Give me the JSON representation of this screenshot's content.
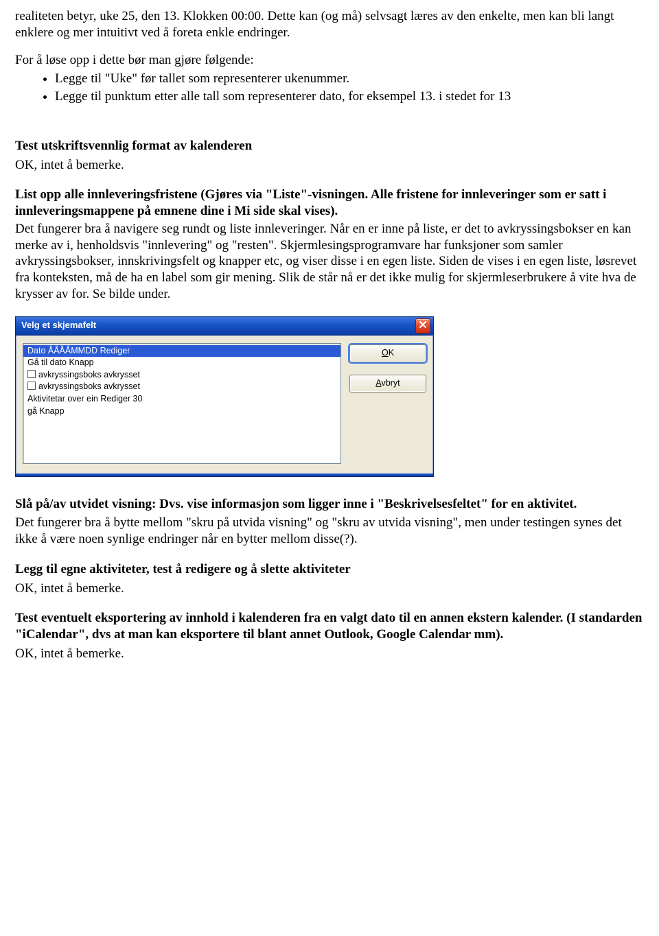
{
  "intro": {
    "p1": "realiteten betyr, uke 25, den 13. Klokken 00:00. Dette kan (og må) selvsagt læres av den enkelte, men kan bli langt enklere og mer intuitivt ved å foreta enkle endringer.",
    "p2": "For å løse opp i dette bør man gjøre følgende:",
    "b1": "Legge til \"Uke\" før tallet som representerer ukenummer.",
    "b2": "Legge til punktum etter alle tall som representerer dato, for eksempel 13. i stedet for 13"
  },
  "section_print": {
    "title": "Test utskriftsvennlig format av kalenderen",
    "body": "OK, intet å bemerke."
  },
  "section_list": {
    "title": "List opp alle innleveringsfristene (Gjøres via \"Liste\"-visningen. Alle fristene for innleveringer som er satt i innleveringsmappene på emnene dine i Mi side skal vises).",
    "body": "Det fungerer bra å navigere seg rundt og liste innleveringer. Når en er inne på liste, er det to avkryssingsbokser en kan merke av i, henholdsvis \"innlevering\" og \"resten\". Skjermlesingsprogramvare har funksjoner som samler avkryssingsbokser, innskrivingsfelt og knapper etc, og viser disse i en egen liste. Siden de vises i en egen liste, løsrevet fra konteksten, må de ha en label som gir mening. Slik de står nå er det ikke mulig for skjermleserbrukere å vite hva de krysser av for. Se bilde under."
  },
  "dialog": {
    "title": "Velg et skjemafelt",
    "items": [
      "Dato ÅÅÅÅMMDD   Rediger",
      "Gå til dato Knapp",
      "avkryssingsboks avkrysset",
      "avkryssingsboks avkrysset",
      "Aktivitetar over ein Rediger 30",
      "gå Knapp"
    ],
    "ok_label": "OK",
    "cancel_label": "Avbryt"
  },
  "section_extended": {
    "title": "Slå på/av utvidet visning: Dvs. vise informasjon som ligger inne i \"Beskrivelsesfeltet\" for en aktivitet.",
    "body": "Det fungerer bra å bytte mellom \"skru på utvida visning\" og \"skru av utvida visning\", men under testingen synes det ikke å være noen synlige endringer når en bytter mellom disse(?)."
  },
  "section_activities": {
    "title": "Legg til egne aktiviteter, test å redigere og å slette aktiviteter",
    "body": "OK, intet å bemerke."
  },
  "section_export": {
    "title": "Test eventuelt eksportering av innhold i kalenderen fra en valgt dato til en annen ekstern kalender. (I standarden \"iCalendar\", dvs at man kan eksportere til blant annet Outlook, Google Calendar mm).",
    "body": "OK, intet å bemerke."
  }
}
